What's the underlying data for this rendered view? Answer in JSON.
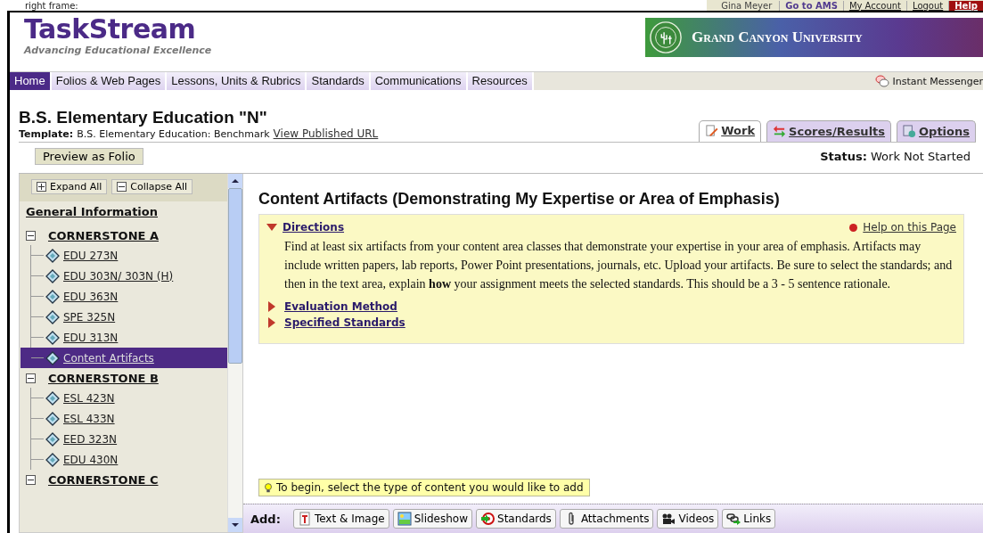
{
  "caption": "right frame:",
  "user_bar": {
    "user": "Gina Meyer",
    "links": [
      {
        "label": "Go to AMS",
        "kind": "ams"
      },
      {
        "label": "My Account",
        "kind": "account"
      },
      {
        "label": "Logout",
        "kind": "logout"
      },
      {
        "label": "Help",
        "kind": "help"
      }
    ]
  },
  "logo": {
    "name": "TaskStream",
    "tagline": "Advancing Educational Excellence"
  },
  "banner": {
    "title": "Grand Canyon University"
  },
  "nav": {
    "tabs": [
      {
        "label": "Home",
        "selected": true
      },
      {
        "label": "Folios & Web Pages",
        "selected": false
      },
      {
        "label": "Lessons, Units & Rubrics",
        "selected": false
      },
      {
        "label": "Standards",
        "selected": false
      },
      {
        "label": "Communications",
        "selected": false
      },
      {
        "label": "Resources",
        "selected": false
      }
    ],
    "messenger": "Instant Messenger"
  },
  "page": {
    "title": "B.S. Elementary Education \"N\"",
    "template_label": "Template:",
    "template": "B.S. Elementary Education: Benchmark",
    "published_link": "View Published URL",
    "preview_button": "Preview as Folio",
    "status_label": "Status:",
    "status": "Work Not Started"
  },
  "view_tabs": [
    {
      "label": "Work",
      "kind": "work",
      "selected": true
    },
    {
      "label": "Scores/Results",
      "kind": "scores",
      "selected": false
    },
    {
      "label": "Options",
      "kind": "options",
      "selected": false
    }
  ],
  "sidebar": {
    "expand": "Expand All",
    "collapse": "Collapse All",
    "general": "General Information",
    "groups": [
      {
        "label": "CORNERSTONE A",
        "expanded": true,
        "children": [
          {
            "label": "EDU 273N",
            "selected": false
          },
          {
            "label": "EDU 303N/ 303N (H)",
            "selected": false
          },
          {
            "label": "EDU 363N",
            "selected": false
          },
          {
            "label": "SPE 325N",
            "selected": false
          },
          {
            "label": "EDU 313N",
            "selected": false
          },
          {
            "label": "Content Artifacts",
            "selected": true
          }
        ]
      },
      {
        "label": "CORNERSTONE B",
        "expanded": true,
        "children": [
          {
            "label": "ESL 423N",
            "selected": false
          },
          {
            "label": "ESL 433N",
            "selected": false
          },
          {
            "label": "EED 323N",
            "selected": false
          },
          {
            "label": "EDU 430N",
            "selected": false
          }
        ]
      },
      {
        "label": "CORNERSTONE C",
        "expanded": true
      }
    ]
  },
  "content": {
    "heading": "Content Artifacts (Demonstrating My Expertise or Area of Emphasis)",
    "help": "Help on this Page",
    "sections": [
      {
        "label": "Directions",
        "expanded": true,
        "body": "Find at least six artifacts from your content area classes that demonstrate your expertise in your area of emphasis. Artifacts may include written papers, lab reports, Power Point presentations, journals, etc. Upload your artifacts. Be sure to select the standards; and then in the text area, explain **how** your assignment meets the selected standards. This should be a 3 - 5 sentence rationale."
      },
      {
        "label": "Evaluation Method",
        "expanded": false
      },
      {
        "label": "Specified Standards",
        "expanded": false
      }
    ],
    "hint": "To begin, select the type of content you would like to add",
    "add_label": "Add:",
    "add_buttons": [
      {
        "label": "Text & Image",
        "kind": "text"
      },
      {
        "label": "Slideshow",
        "kind": "slideshow"
      },
      {
        "label": "Standards",
        "kind": "standards"
      },
      {
        "label": "Attachments",
        "kind": "attachments"
      },
      {
        "label": "Videos",
        "kind": "videos"
      },
      {
        "label": "Links",
        "kind": "links"
      }
    ]
  }
}
